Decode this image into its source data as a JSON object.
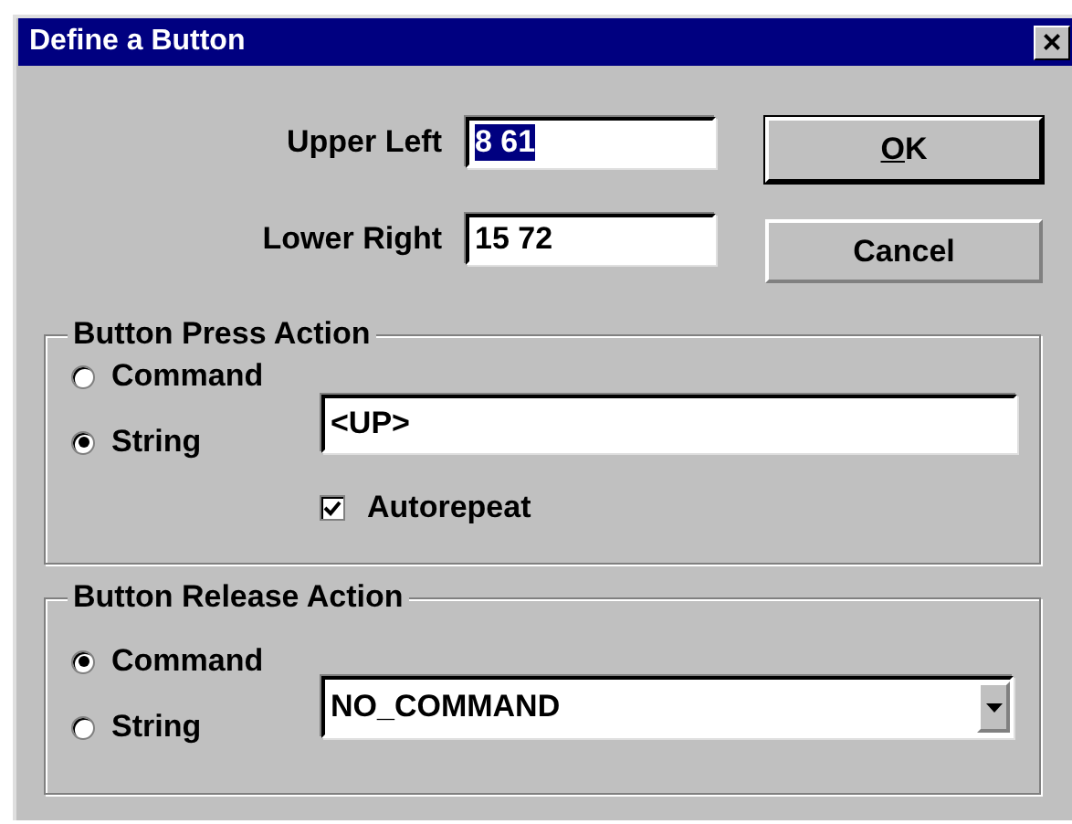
{
  "window": {
    "title": "Define a Button",
    "close": "×"
  },
  "coordinates": [
    {
      "label": "Upper Left",
      "value": "8 61",
      "selected": true
    },
    {
      "label": "Lower Right",
      "value": "15 72",
      "selected": false
    }
  ],
  "buttons": [
    {
      "label": "OK",
      "default": true,
      "mnemonic": true
    },
    {
      "label": "Cancel",
      "default": false,
      "mnemonic": false
    }
  ],
  "press_action": {
    "title": "Button Press Action",
    "options": [
      {
        "label": "Command",
        "selected": false
      },
      {
        "label": "String",
        "selected": true
      }
    ],
    "kind": "text",
    "value": "<UP>",
    "autorepeat": {
      "label": "Autorepeat",
      "checked": true
    }
  },
  "release_action": {
    "title": "Button Release Action",
    "options": [
      {
        "label": "Command",
        "selected": true
      },
      {
        "label": "String",
        "selected": false
      }
    ],
    "kind": "dropdown",
    "value": "NO_COMMAND"
  }
}
